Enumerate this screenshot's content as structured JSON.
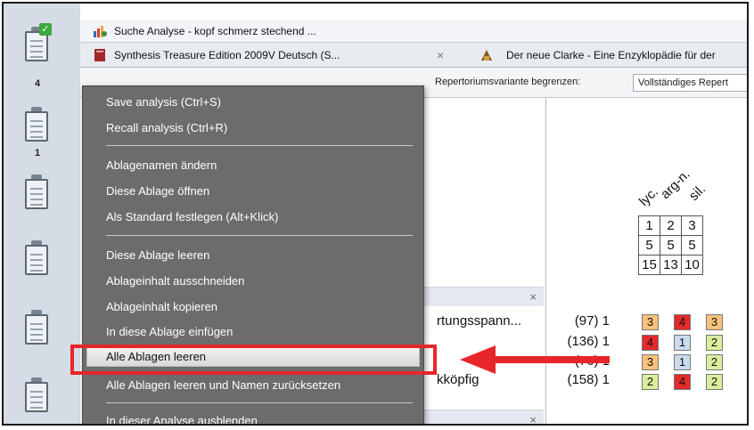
{
  "window": {
    "tab1_title": "Suche Analyse - kopf schmerz stechend ...",
    "tab2_title": "Synthesis Treasure Edition 2009V Deutsch (S...",
    "tab2_close": "×",
    "tab3_title": "Der neue Clarke - Eine Enzyklopädie für der"
  },
  "sidebar": {
    "clipboards": [
      {
        "number": "4",
        "checked": true
      },
      {
        "number": "1",
        "checked": false
      },
      {
        "number": "",
        "checked": false
      },
      {
        "number": "",
        "checked": false
      },
      {
        "number": "",
        "checked": false
      },
      {
        "number": "",
        "checked": false
      }
    ]
  },
  "toolbar": {
    "variant_label": "Repertoriumsvariante begrenzen:",
    "variant_value": "Vollständiges Repert"
  },
  "context_menu": {
    "items": [
      "Save analysis (Ctrl+S)",
      "Recall analysis (Ctrl+R)",
      "Ablagenamen ändern",
      "Diese Ablage öffnen",
      "Als Standard festlegen (Alt+Klick)",
      "Diese Ablage leeren",
      "Ablageinhalt ausschneiden",
      "Ablageinhalt kopieren",
      "In diese Ablage einfügen",
      "Alle Ablagen leeren",
      "Alle Ablagen leeren und Namen zurücksetzen",
      "In dieser Analyse ausblenden"
    ],
    "highlighted_item": "Alle Ablagen leeren"
  },
  "analysis": {
    "remedies": [
      "lyc.",
      "arg-n.",
      "sil."
    ],
    "row_numbers": [
      "1",
      "2",
      "3"
    ],
    "row_symptoms": [
      "5",
      "5",
      "5"
    ],
    "row_degrees": [
      "15",
      "13",
      "10"
    ],
    "rubrics": [
      {
        "text": "rtungsspann...",
        "count": "(97) 1",
        "cells": [
          "3",
          "4",
          "3"
        ]
      },
      {
        "text": "",
        "count": "(136) 1",
        "cells": [
          "4",
          "1",
          "2"
        ]
      },
      {
        "text": "",
        "count": "(76) 1",
        "cells": [
          "3",
          "1",
          "2"
        ]
      },
      {
        "text": "kköpfig",
        "count": "(158) 1",
        "cells": [
          "2",
          "4",
          "2"
        ]
      }
    ],
    "section_close": "×"
  },
  "colors": {
    "menu_bg": "#6c6c6c",
    "highlight_box": "#e6262a",
    "grade_orange": "#f7c27a",
    "grade_red": "#e22a2a",
    "grade_blue": "#c9dcef",
    "grade_green": "#d9ef9c"
  }
}
